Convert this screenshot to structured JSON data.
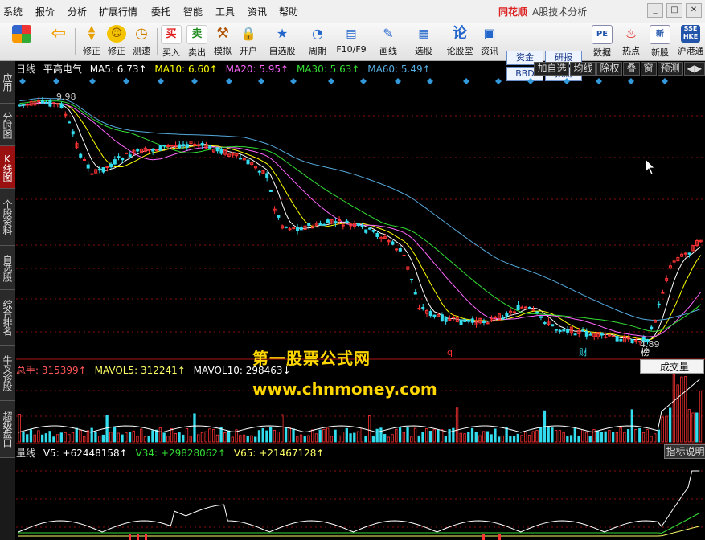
{
  "menu": [
    "系统",
    "报价",
    "分析",
    "扩展行情",
    "委托",
    "智能",
    "工具",
    "资讯",
    "帮助"
  ],
  "brand": {
    "logo": "同花顺",
    "subtitle": "A股技术分析"
  },
  "toolbar": [
    {
      "icon": "layout-icon",
      "label": ""
    },
    {
      "icon": "back-arrow-icon",
      "label": ""
    },
    {
      "icon": "up-down-icon",
      "label": "修正"
    },
    {
      "icon": "smile-icon",
      "label": "修正"
    },
    {
      "icon": "clock-icon",
      "label": "测速"
    },
    {
      "icon": "buy-icon",
      "label": "买入"
    },
    {
      "icon": "sell-icon",
      "label": "卖出"
    },
    {
      "icon": "hammer-icon",
      "label": "模拟"
    },
    {
      "icon": "lock-icon",
      "label": "开户"
    },
    {
      "icon": "star-folder-icon",
      "label": "自选股"
    },
    {
      "icon": "period-clock-icon",
      "label": "周期"
    },
    {
      "icon": "f10-icon",
      "label": "F10/F9"
    },
    {
      "icon": "pencil-icon",
      "label": "画线"
    },
    {
      "icon": "select-stock-icon",
      "label": "选股"
    },
    {
      "icon": "forum-icon",
      "label": "论股堂"
    },
    {
      "icon": "news-icon",
      "label": "资讯"
    },
    {
      "icon": "pe-icon",
      "label": "数据"
    },
    {
      "icon": "hot-icon",
      "label": "热点"
    },
    {
      "icon": "new-stock-icon",
      "label": "新股"
    },
    {
      "icon": "hk-connect-icon",
      "label": "沪港通"
    }
  ],
  "toolbar_right_buttons": [
    "资金",
    "BBD",
    "研报",
    "预测"
  ],
  "sidebar_tabs": [
    "应用",
    "分时图",
    "K线图",
    "个股资料",
    "自选股",
    "综合排名",
    "牛叉诊股",
    "超级盘口"
  ],
  "active_tab": "K线图",
  "price_panel": {
    "period": "日线",
    "stock_name": "平高电气",
    "ma": [
      {
        "label": "MA5: 6.73↑",
        "color": "#ffffff"
      },
      {
        "label": "MA10: 6.60↑",
        "color": "#ffff00"
      },
      {
        "label": "MA20: 5.95↑",
        "color": "#ff66ff"
      },
      {
        "label": "MA30: 5.63↑",
        "color": "#33dd33"
      },
      {
        "label": "MA60: 5.49↑",
        "color": "#55aadd"
      }
    ],
    "tools": [
      "加自选",
      "均线",
      "除权",
      "叠",
      "窗",
      "预测",
      "◀▶"
    ],
    "high_label": "9.98",
    "low_label": "4.89",
    "tags": {
      "q": "q",
      "cai": "财",
      "bang": "榜"
    }
  },
  "volume_panel": {
    "label": "总手: 315399↑",
    "mavol5": "MAVOL5: 312241↑",
    "mavol10": "MAVOL10: 298463↓",
    "selector": "成交量"
  },
  "indicator_panel": {
    "label": "量线",
    "v5": "V5: +62448158↑",
    "v34": "V34: +29828062↑",
    "v65": "V65: +21467128↑",
    "help_button": "指标说明"
  },
  "watermark": {
    "line1": "第一股票公式网",
    "line2": "www.chnmoney.com"
  },
  "colors": {
    "up": "#ff3333",
    "down": "#33ddee",
    "ma5": "#ffffff",
    "ma10": "#ffff00",
    "ma20": "#ff66ff",
    "ma30": "#33dd33",
    "ma60": "#55aadd"
  }
}
